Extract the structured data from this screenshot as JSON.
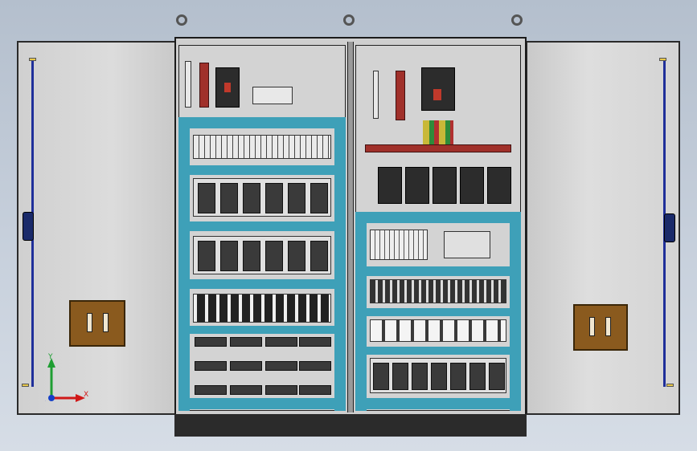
{
  "axes": {
    "x_label": "X",
    "y_label": "Y",
    "z_label": "Z"
  },
  "colors": {
    "background": "#c4cdd9",
    "door_rod": "#1f2f9a",
    "mounting_rail": "#3ea0b8",
    "busbar": "#a0302a",
    "handle": "#8a5a1e"
  },
  "icons": [
    "eyebolt-icon",
    "axis-triad-icon",
    "door-handle-icon"
  ]
}
